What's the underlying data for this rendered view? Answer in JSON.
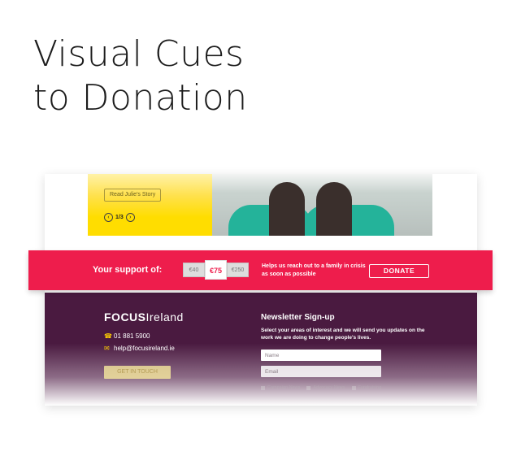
{
  "headline": {
    "line1": "Visual Cues",
    "line2": "to Donation"
  },
  "story": {
    "button_label": "Read Julie's Story",
    "pager": {
      "prev_icon": "chevron-left-icon",
      "count": "1/3",
      "next_icon": "chevron-right-icon"
    }
  },
  "donate_bar": {
    "support_label": "Your support of:",
    "amounts": [
      "€40",
      "€75",
      "€250"
    ],
    "selected_amount": "€75",
    "helps_text": "Helps us reach out to a family in crisis as soon as possible",
    "donate_label": "DONATE",
    "color": "#ee1d4c"
  },
  "footer": {
    "logo": {
      "bold": "FOCUS",
      "light": "Ireland"
    },
    "phone": "01 881 5900",
    "email": "help@focusireland.ie",
    "get_in_touch": "GET IN TOUCH",
    "newsletter": {
      "title": "Newsletter Sign-up",
      "text": "Select your areas of interest and we will send you updates on the work we are doing to change people's lives.",
      "name_placeholder": "Name",
      "email_placeholder": "Email",
      "checkboxes": [
        "Campaign News",
        "Advocacy News",
        "Fundraising"
      ]
    },
    "background": "#4a1a40",
    "accent": "#ffcf00"
  }
}
